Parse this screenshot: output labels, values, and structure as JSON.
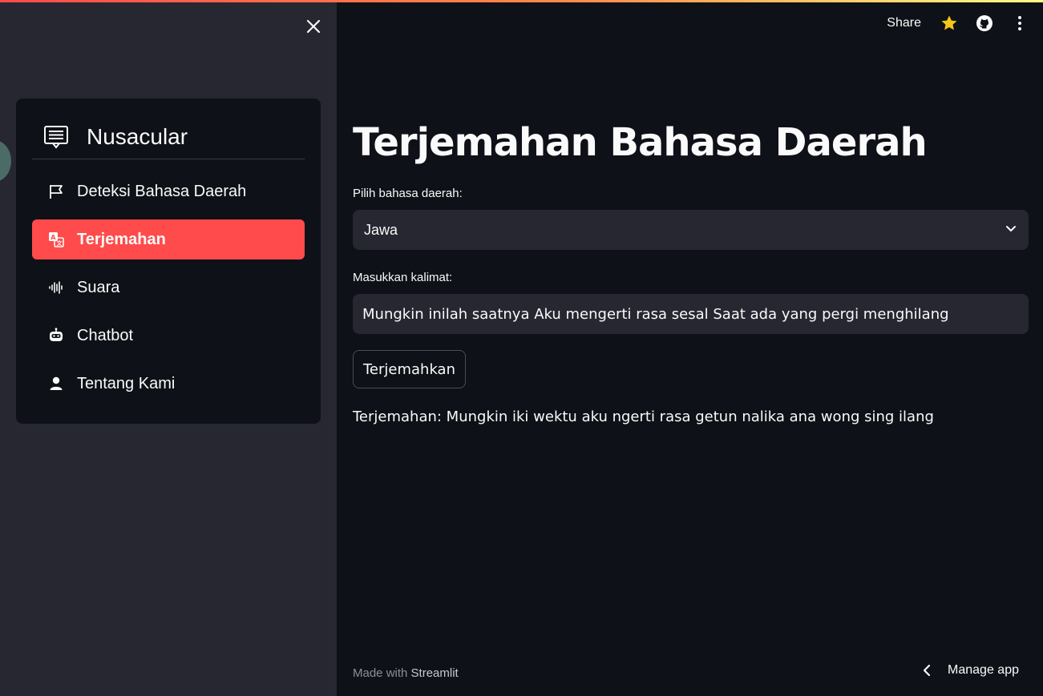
{
  "sidebar": {
    "close_icon": "close-icon",
    "menu": {
      "title": "Nusacular",
      "title_icon": "message-list-icon",
      "items": [
        {
          "label": "Deteksi Bahasa Daerah",
          "icon": "flag-icon",
          "active": false
        },
        {
          "label": "Terjemahan",
          "icon": "translate-icon",
          "active": true
        },
        {
          "label": "Suara",
          "icon": "soundwave-icon",
          "active": false
        },
        {
          "label": "Chatbot",
          "icon": "robot-icon",
          "active": false
        },
        {
          "label": "Tentang Kami",
          "icon": "person-icon",
          "active": false
        }
      ]
    }
  },
  "header": {
    "share_label": "Share",
    "icons": [
      "star-icon",
      "github-icon",
      "more-vert-icon"
    ]
  },
  "main": {
    "title": "Terjemahan Bahasa Daerah",
    "language_label": "Pilih bahasa daerah:",
    "language_value": "Jawa",
    "sentence_label": "Masukkan kalimat:",
    "sentence_value": "Mungkin inilah saatnya Aku mengerti rasa sesal Saat ada yang pergi menghilang",
    "translate_button": "Terjemahkan",
    "result": "Terjemahan: Mungkin iki wektu aku ngerti rasa getun nalika ana wong sing ilang"
  },
  "footer": {
    "made_with": "Made with",
    "brand": "Streamlit",
    "manage_app": "Manage app"
  },
  "colors": {
    "accent": "#ff4b4b",
    "background": "#0e1117",
    "sidebar": "#262730",
    "star": "#f5c518"
  }
}
